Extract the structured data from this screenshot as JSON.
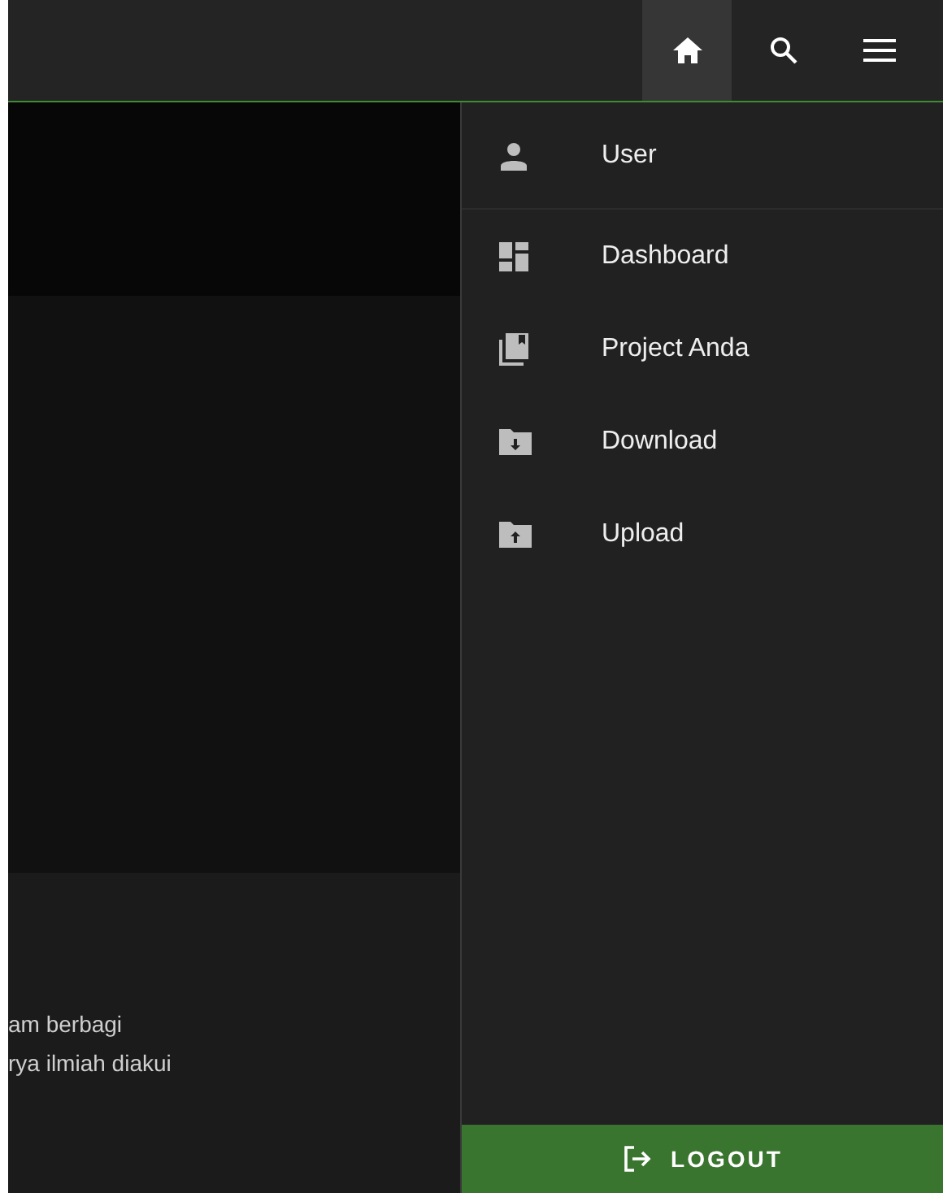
{
  "header": {
    "buttons": [
      {
        "kind": "home",
        "selected": true
      },
      {
        "kind": "search",
        "selected": false
      },
      {
        "kind": "menu",
        "selected": false
      }
    ]
  },
  "background_text": [
    "am berbagi",
    "rya ilmiah diakui"
  ],
  "drawer": {
    "items": [
      {
        "kind": "user",
        "label": "User"
      },
      {
        "kind": "dashboard",
        "label": "Dashboard"
      },
      {
        "kind": "project",
        "label": "Project Anda"
      },
      {
        "kind": "download",
        "label": "Download"
      },
      {
        "kind": "upload",
        "label": "Upload"
      }
    ],
    "logout": "LOGOUT"
  }
}
